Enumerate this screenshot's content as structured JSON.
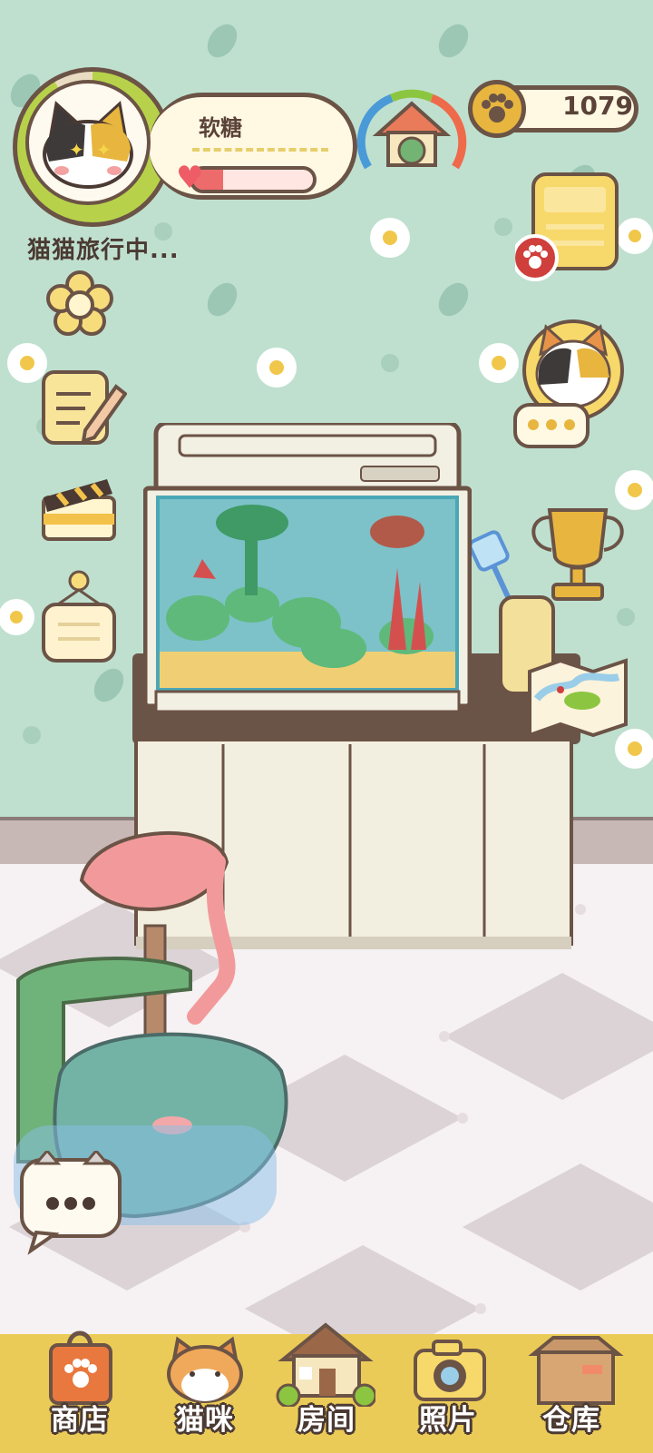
{
  "profile": {
    "cat_name": "软糖",
    "hp_fraction": 0.25,
    "status": "猫猫旅行中..."
  },
  "currency": {
    "icon": "paw-coin-icon",
    "amount": "1079"
  },
  "side_buttons_left": [
    {
      "icon": "flower-icon"
    },
    {
      "icon": "notepad-pencil-icon"
    },
    {
      "icon": "clapperboard-icon"
    },
    {
      "icon": "hanging-sign-icon"
    }
  ],
  "side_buttons_right": [
    {
      "icon": "mail-letter-icon"
    },
    {
      "icon": "calico-cat-chat-icon"
    },
    {
      "icon": "trophy-icon"
    },
    {
      "icon": "map-icon"
    }
  ],
  "bottom_nav": [
    {
      "id": "shop",
      "label": "商店",
      "icon": "shopping-bag-icon"
    },
    {
      "id": "cats",
      "label": "猫咪",
      "icon": "cat-face-icon"
    },
    {
      "id": "room",
      "label": "房间",
      "icon": "house-icon"
    },
    {
      "id": "photos",
      "label": "照片",
      "icon": "camera-icon"
    },
    {
      "id": "storage",
      "label": "仓库",
      "icon": "cardboard-box-icon"
    }
  ],
  "colors": {
    "wall": "#bfe0cf",
    "outline": "#6b5346",
    "nav_bar": "#ebcb57",
    "panel": "#fff8e3",
    "hp": "#ee6b6b"
  }
}
